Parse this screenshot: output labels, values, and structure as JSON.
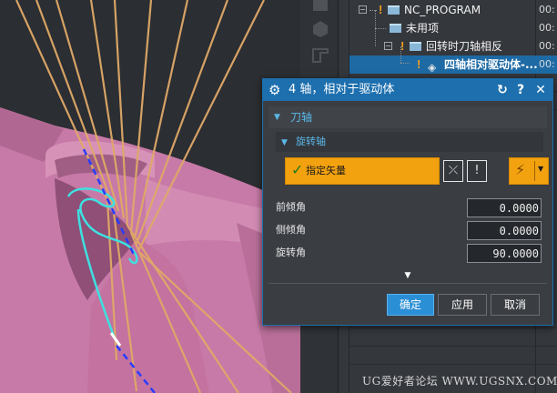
{
  "navigator": {
    "rows": [
      {
        "label": "NC_PROGRAM",
        "col2": "00:"
      },
      {
        "label": "未用项",
        "col2": "00:"
      },
      {
        "label": "回转时刀轴相反",
        "col2": "00:"
      },
      {
        "label": "四轴相对驱动体-...",
        "col2": "00:"
      }
    ]
  },
  "dialog": {
    "title": "4 轴，相对于驱动体",
    "section_label": "刀轴",
    "subsection_label": "旋转轴",
    "specify_vector_label": "指定矢量",
    "fields": [
      {
        "label": "前倾角",
        "value": "0.0000"
      },
      {
        "label": "侧倾角",
        "value": "0.0000"
      },
      {
        "label": "旋转角",
        "value": "90.0000"
      }
    ],
    "ok_label": "确定",
    "apply_label": "应用",
    "cancel_label": "取消",
    "reset_symbol": "↻",
    "help_symbol": "?",
    "close_symbol": "✕"
  },
  "watermark": "UG爱好者论坛 WWW.UGSNX.COM",
  "colors": {
    "title_bar": "#1d6fae",
    "accent_blue": "#5ab8e8",
    "orange_button": "#f3a20f",
    "ok_button": "#2b8fd6",
    "part_pink": "#c77aa7",
    "tool_lines": "#e8b070"
  },
  "icons": [
    "gear-icon",
    "reset-icon",
    "help-icon",
    "close-icon",
    "check-icon",
    "vector-dialog-icon",
    "vector-reverse-icon",
    "inferred-vector-icon",
    "dropdown-arrow-icon",
    "expand-more-icon",
    "folder-icon",
    "warning-icon"
  ]
}
